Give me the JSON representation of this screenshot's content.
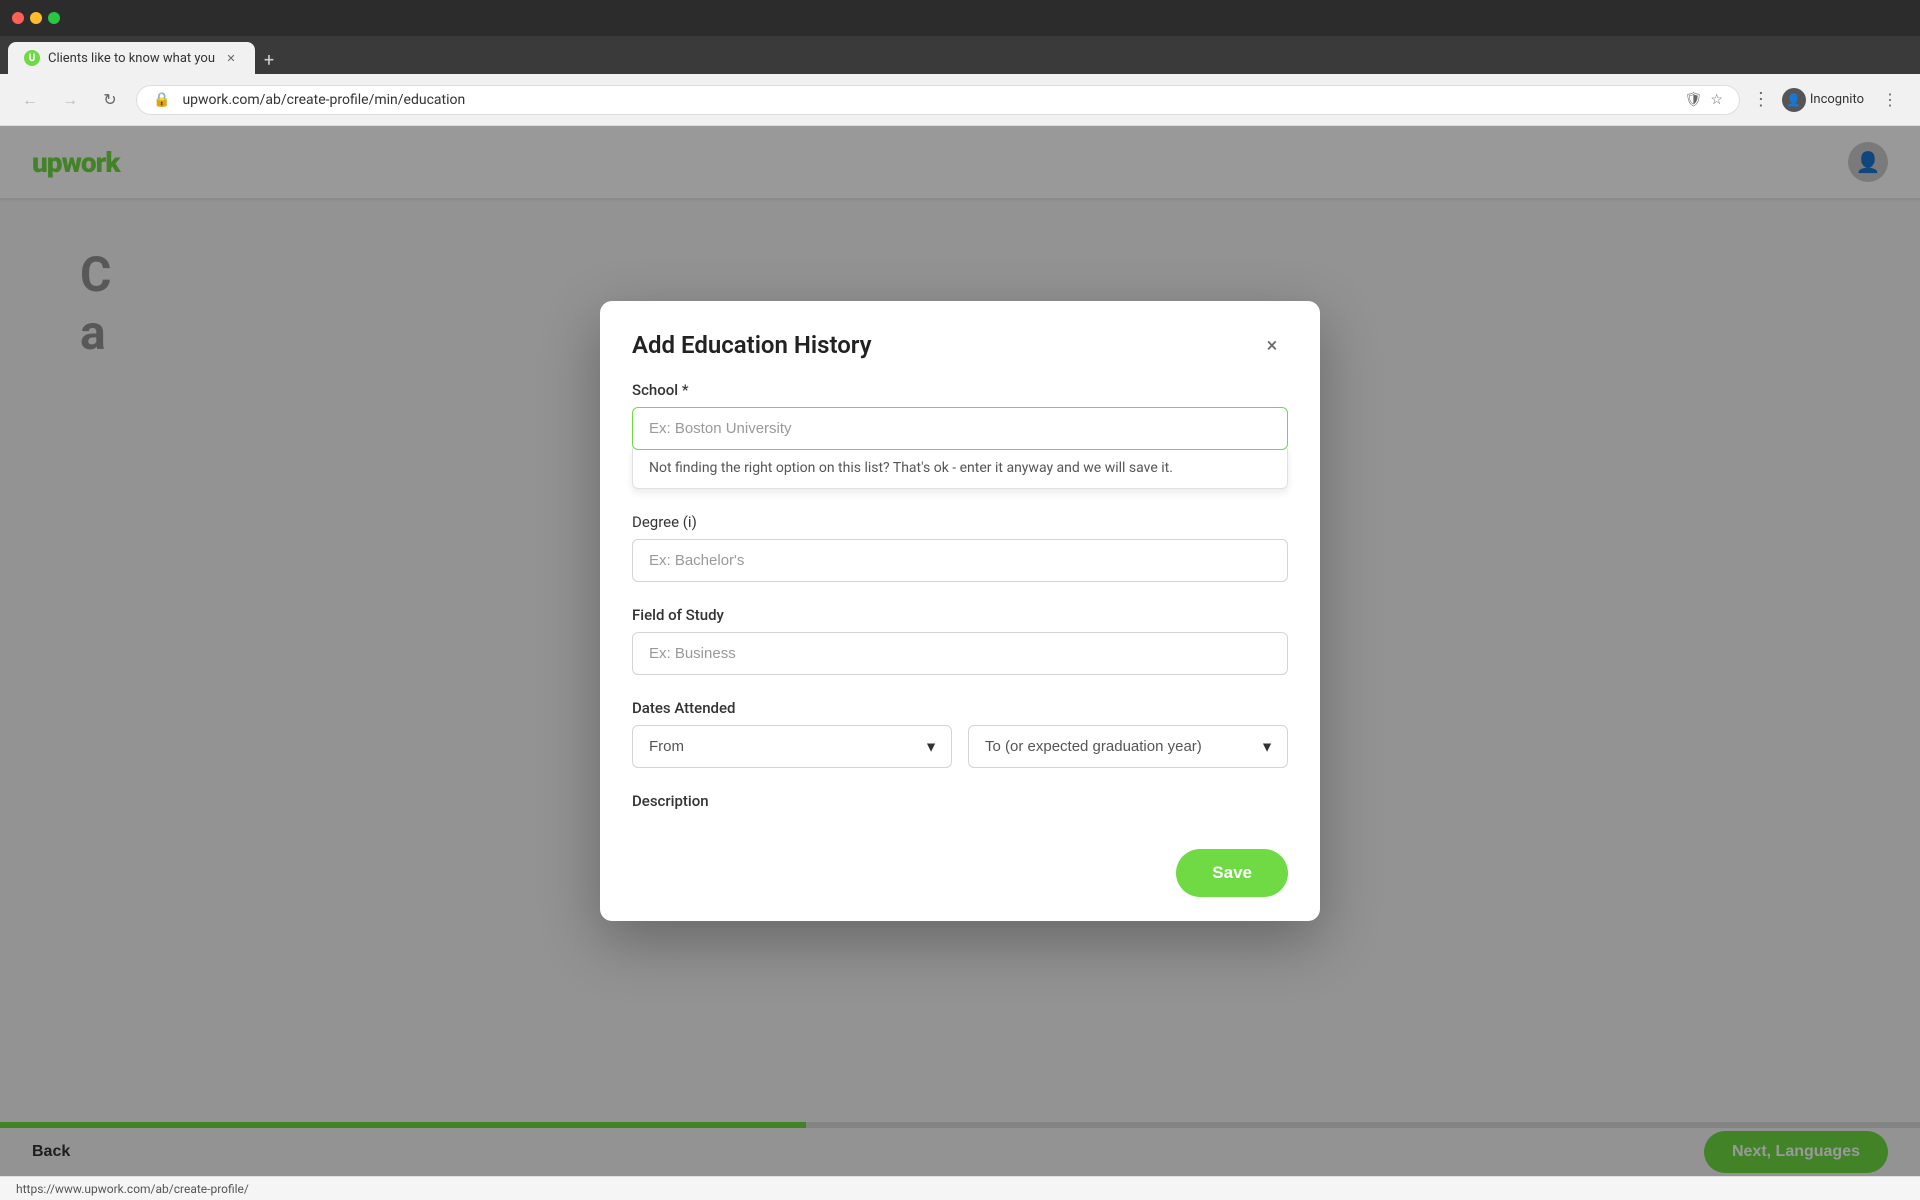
{
  "browser": {
    "tab_title": "Clients like to know what you",
    "tab_favicon": "U",
    "address": "upwork.com/ab/create-profile/min/education",
    "address_full": "https://upwork.com/ab/create-profile/min/education",
    "incognito_label": "Incognito",
    "new_tab_label": "+",
    "status_url": "https://www.upwork.com/ab/create-profile/"
  },
  "header": {
    "logo": "upwork",
    "avatar_icon": "👤"
  },
  "background_page": {
    "title_line1": "C",
    "title_line2": "a"
  },
  "modal": {
    "title": "Add Education History",
    "close_label": "×",
    "school": {
      "label": "School",
      "required": true,
      "placeholder": "Ex: Boston University",
      "hint": "Not finding the right option on this list? That's ok - enter it anyway and we will save it."
    },
    "degree": {
      "label": "Degree (i)",
      "placeholder": "Ex: Bachelor's"
    },
    "field_of_study": {
      "label": "Field of Study",
      "placeholder": "Ex: Business"
    },
    "dates_attended": {
      "label": "Dates Attended",
      "from_placeholder": "From",
      "to_placeholder": "To (or expected graduation year)"
    },
    "description": {
      "label": "Description"
    },
    "save_button": "Save"
  },
  "footer": {
    "back_label": "Back",
    "next_label": "Next, Languages"
  },
  "progress": {
    "percent": 42
  }
}
